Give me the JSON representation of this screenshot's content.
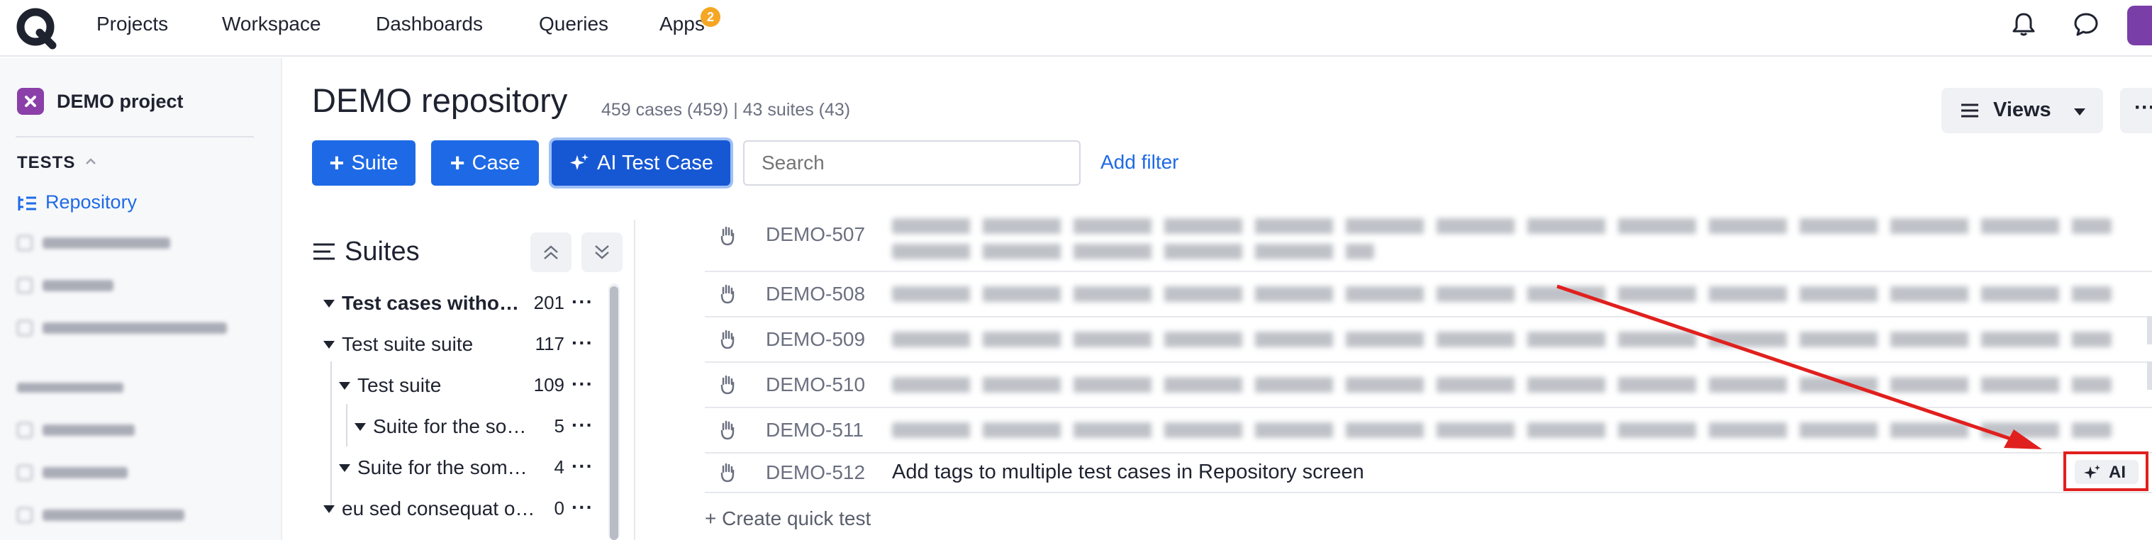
{
  "topnav": {
    "items": [
      "Projects",
      "Workspace",
      "Dashboards",
      "Queries",
      "Apps"
    ],
    "apps_badge": "2"
  },
  "sidebar": {
    "project_name": "DEMO project",
    "tests_header": "TESTS",
    "active_item": "Repository"
  },
  "header": {
    "title": "DEMO repository",
    "stats": "459 cases (459) | 43 suites (43)",
    "views_label": "Views",
    "more_label": "···"
  },
  "toolbar": {
    "suite_label": "Suite",
    "case_label": "Case",
    "ai_label": "AI Test Case",
    "search_placeholder": "Search",
    "add_filter": "Add filter"
  },
  "suites": {
    "title": "Suites",
    "rows": [
      {
        "name": "Test cases witho…",
        "count": "201",
        "bold": true
      },
      {
        "name": "Test suite suite",
        "count": "117",
        "bold": false
      },
      {
        "name": "Test suite",
        "count": "109",
        "bold": false
      },
      {
        "name": "Suite for the so…",
        "count": "5",
        "bold": false
      },
      {
        "name": "Suite for the som…",
        "count": "4",
        "bold": false
      },
      {
        "name": "eu sed consequat o…",
        "count": "0",
        "bold": false
      }
    ],
    "dots": "···"
  },
  "cases": [
    {
      "id": "DEMO-507",
      "title": ""
    },
    {
      "id": "DEMO-508",
      "title": ""
    },
    {
      "id": "DEMO-509",
      "title": ""
    },
    {
      "id": "DEMO-510",
      "title": ""
    },
    {
      "id": "DEMO-511",
      "title": ""
    },
    {
      "id": "DEMO-512",
      "title": "Add tags to multiple test cases in Repository screen"
    }
  ],
  "ai_badge": "AI",
  "quick_test": "+ Create quick test",
  "colors": {
    "accent": "#1e6ae6",
    "annotation": "#e0201e",
    "badge": "#f5a623",
    "project": "#8b3fa8"
  }
}
